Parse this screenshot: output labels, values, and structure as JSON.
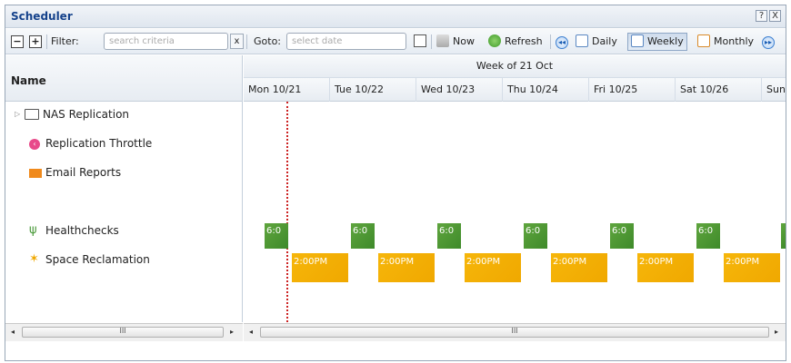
{
  "window": {
    "title": "Scheduler",
    "help": "?",
    "close": "X"
  },
  "toolbar": {
    "collapse": "−",
    "expand": "+",
    "filter_label": "Filter:",
    "filter_placeholder": "search criteria",
    "clear": "x",
    "goto_label": "Goto:",
    "goto_placeholder": "select date",
    "now": "Now",
    "refresh": "Refresh",
    "prev": "◂◂",
    "daily": "Daily",
    "weekly": "Weekly",
    "monthly": "Monthly",
    "next": "▸▸",
    "active_view": "weekly"
  },
  "left": {
    "header": "Name",
    "rows": [
      {
        "label": "NAS Replication",
        "icon": "folder-icon"
      },
      {
        "label": "Replication Throttle",
        "icon": "throttle-icon",
        "color": "#e84a8a"
      },
      {
        "label": "Email Reports",
        "icon": "envelope-icon",
        "color": "#f08a1c"
      },
      {
        "label": "Healthchecks",
        "icon": "stethoscope-icon",
        "color": "#4a9a3a"
      },
      {
        "label": "Space Reclamation",
        "icon": "sparkle-icon",
        "color": "#f0a800"
      }
    ]
  },
  "calendar": {
    "week_label": "Week of 21 Oct",
    "days": [
      "Mon 10/21",
      "Tue 10/22",
      "Wed 10/23",
      "Thu 10/24",
      "Fri 10/25",
      "Sat 10/26",
      "Sun"
    ],
    "healthcheck_label": "6:0",
    "reclamation_label": "2:00PM",
    "colors": {
      "healthcheck": "#4c962f",
      "reclamation": "#f4b000",
      "now_line": "#cc2222"
    }
  },
  "scroll": {
    "thumb_mark": "III"
  }
}
